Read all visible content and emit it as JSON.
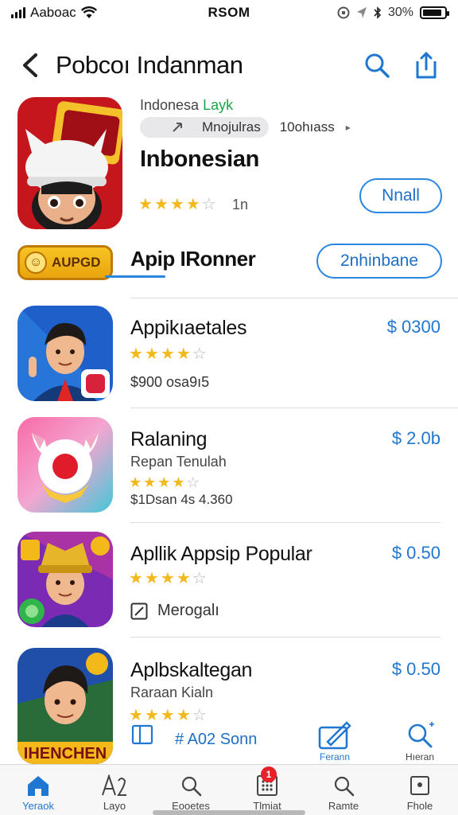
{
  "status": {
    "carrier": "Aaboac",
    "time": "RSOM",
    "battery": "30%",
    "battery_level": 0.9
  },
  "nav": {
    "title": "Pobcoı Indanman",
    "back_icon": "chevron-left-icon",
    "search_icon": "search-icon",
    "share_icon": "share-icon"
  },
  "featured": {
    "developer_prefix": "Indonesa",
    "developer_suffix": "Layk",
    "tag_label": "Mnojulras",
    "tag_extra": "10ohıass",
    "name": "Inbonesian",
    "rating": 4,
    "rating_count": "1n",
    "install_label": "Nnall"
  },
  "promo": {
    "badge_label": "AUPGD",
    "title": "Apip IRonner",
    "button_label": "2nhinbane"
  },
  "apps": [
    {
      "name": "Appikıaetales",
      "price": "$ 0300",
      "rating": 4,
      "sub": "$900 osa9ı5",
      "sub2": ""
    },
    {
      "name": "Ralaning",
      "price": "$ 2.0b",
      "rating": 4,
      "sub": "Repan Tenulah",
      "sub2": "$1Dsan 4s 4.360"
    },
    {
      "name": "Apllik Appsip Popular",
      "price": "$ 0.50",
      "rating": 4,
      "sub": "",
      "meta": "Merogalı"
    },
    {
      "name": "Aplbskaltegan",
      "price": "$ 0.50",
      "rating": 4,
      "sub": "Raraan Kialn",
      "meta": "# A02 Sonn"
    }
  ],
  "actions": {
    "left_label": "Ferann",
    "right_label": "Hıeran"
  },
  "tabs": [
    {
      "label": "Yeraok",
      "icon": "home-icon"
    },
    {
      "label": "Layo",
      "icon": "apps-icon"
    },
    {
      "label": "Eooetes",
      "icon": "search-icon"
    },
    {
      "label": "Tlmiat",
      "icon": "grid-icon",
      "badge": "1"
    },
    {
      "label": "Ramte",
      "icon": "search-icon"
    },
    {
      "label": "Fhole",
      "icon": "profile-icon"
    }
  ],
  "colors": {
    "accent": "#1f77d1",
    "star": "#f3b81a",
    "badge": "#e82027"
  }
}
